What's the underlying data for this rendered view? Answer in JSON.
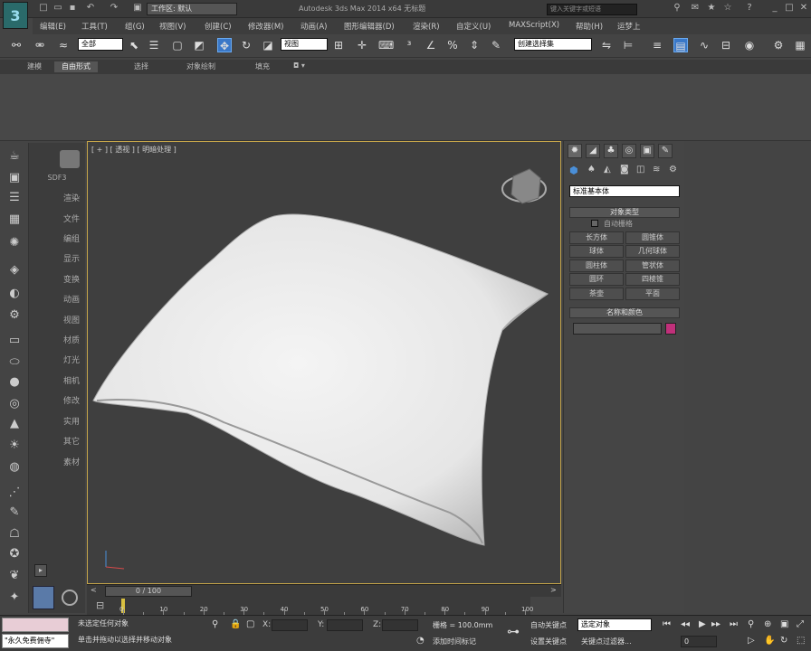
{
  "titlebar": {
    "workspace": "工作区: 默认",
    "app_title": "Autodesk 3ds Max  2014 x64     无标题",
    "search_placeholder": "键入关键字或短语"
  },
  "menubar": [
    "编辑(E)",
    "工具(T)",
    "组(G)",
    "视图(V)",
    "创建(C)",
    "修改器(M)",
    "动画(A)",
    "图形编辑器(D)",
    "渲染(R)",
    "自定义(U)",
    "MAXScript(X)",
    "帮助(H)",
    "运梦上"
  ],
  "toolbar": {
    "selection_filter": "全部",
    "coord_system": "视图",
    "named_selection": "创建选择集"
  },
  "ribbon_tabs": [
    "建模",
    "自由形式",
    "选择",
    "对象绘制",
    "填充"
  ],
  "viewport": {
    "label": "[ + ] [ 透视 ] [ 明暗处理 ]"
  },
  "scene_panel": [
    "SDF3",
    "渲染",
    "文件",
    "编组",
    "显示",
    "变换",
    "动画",
    "视图",
    "材质",
    "灯光",
    "相机",
    "修改",
    "实用",
    "其它",
    "素材"
  ],
  "command_panel": {
    "category": "标准基本体",
    "object_type_header": "对象类型",
    "autogrid": "自动栅格",
    "objects": [
      "长方体",
      "圆锥体",
      "球体",
      "几何球体",
      "圆柱体",
      "管状体",
      "圆环",
      "四棱锥",
      "茶壶",
      "平面"
    ],
    "name_color_header": "名称和颜色",
    "object_color": "#c0307a"
  },
  "timeline": {
    "slider": "0 / 100",
    "ticks": [
      "0",
      "10",
      "20",
      "30",
      "40",
      "50",
      "60",
      "70",
      "80",
      "90",
      "100"
    ]
  },
  "status": {
    "maxscript": "\"永久免费佣寺\"",
    "selection_text": "未选定任何对象",
    "prompt": "单击并拖动以选择并移动对象",
    "x_label": "X:",
    "y_label": "Y:",
    "z_label": "Z:",
    "grid": "栅格 = 100.0mm",
    "add_time_tag": "添加时间标记",
    "auto_key": "自动关键点",
    "selected": "选定对象",
    "set_key": "设置关键点",
    "key_filters": "关键点过滤器...",
    "frame": "0"
  }
}
